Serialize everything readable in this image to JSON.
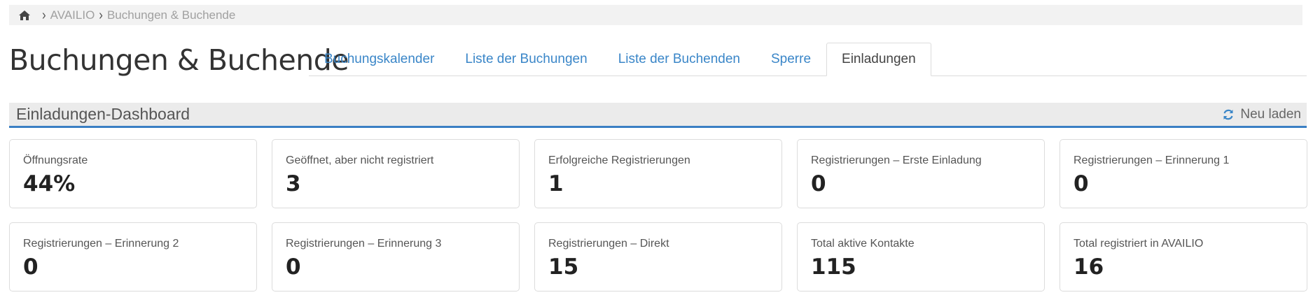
{
  "breadcrumb": {
    "home_icon": "home-icon",
    "items": [
      "AVAILIO",
      "Buchungen & Buchende"
    ]
  },
  "page": {
    "title": "Buchungen & Buchende"
  },
  "tabs": [
    {
      "label": "Buchungskalender",
      "active": false
    },
    {
      "label": "Liste der Buchungen",
      "active": false
    },
    {
      "label": "Liste der Buchenden",
      "active": false
    },
    {
      "label": "Sperre",
      "active": false
    },
    {
      "label": "Einladungen",
      "active": true
    }
  ],
  "section": {
    "title": "Einladungen-Dashboard",
    "reload_label": "Neu laden",
    "reload_icon": "refresh-icon",
    "accent_color": "#3a7fc4"
  },
  "cards": [
    {
      "label": "Öffnungsrate",
      "value": "44%"
    },
    {
      "label": "Geöffnet, aber nicht registriert",
      "value": "3"
    },
    {
      "label": "Erfolgreiche Registrierungen",
      "value": "1"
    },
    {
      "label": "Registrierungen – Erste Einladung",
      "value": "0"
    },
    {
      "label": "Registrierungen – Erinnerung 1",
      "value": "0"
    },
    {
      "label": "Registrierungen – Erinnerung 2",
      "value": "0"
    },
    {
      "label": "Registrierungen – Erinnerung 3",
      "value": "0"
    },
    {
      "label": "Registrierungen – Direkt",
      "value": "15"
    },
    {
      "label": "Total aktive Kontakte",
      "value": "115"
    },
    {
      "label": "Total registriert in AVAILIO",
      "value": "16"
    }
  ]
}
